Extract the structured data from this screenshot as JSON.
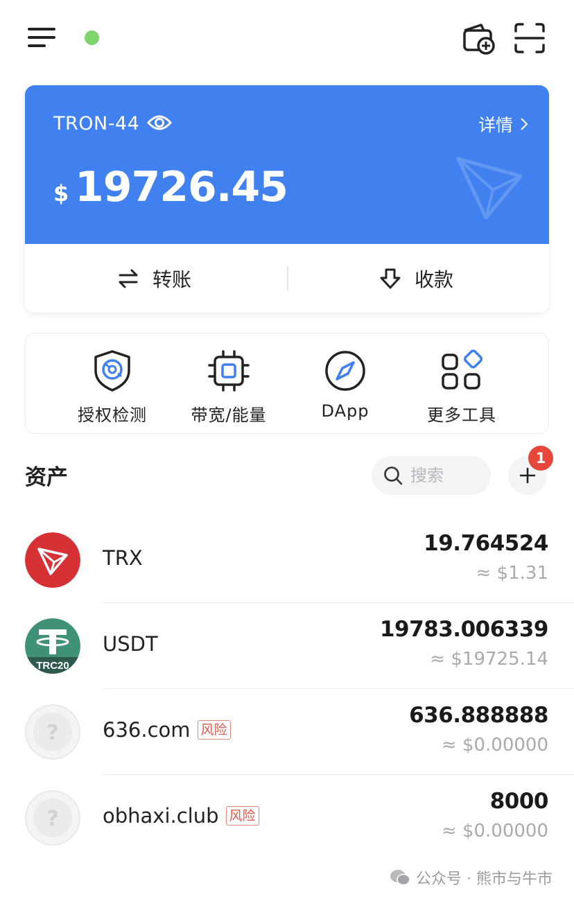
{
  "header": {
    "menu_icon": "hamburger-menu-icon",
    "status_color": "#7fd36a",
    "wallet_add_icon": "wallet-add-icon",
    "scan_icon": "scan-icon"
  },
  "card": {
    "wallet_name": "TRON-44",
    "details_label": "详情",
    "currency_sign": "$",
    "balance": "19726.45",
    "accent_color": "#4180ef",
    "transfer_label": "转账",
    "receive_label": "收款"
  },
  "tools": [
    {
      "label": "授权检测",
      "icon": "shield-check-icon"
    },
    {
      "label": "带宽/能量",
      "icon": "chip-icon"
    },
    {
      "label": "DApp",
      "icon": "compass-icon"
    },
    {
      "label": "更多工具",
      "icon": "grid-icon"
    }
  ],
  "assets": {
    "title": "资产",
    "search_placeholder": "搜索",
    "badge_count": "1",
    "items": [
      {
        "name": "TRX",
        "amount": "19.764524",
        "value": "≈ $1.31",
        "risk": ""
      },
      {
        "name": "USDT",
        "amount": "19783.006339",
        "value": "≈ $19725.14",
        "risk": "",
        "logo_text": "TRC20"
      },
      {
        "name": "636.com",
        "amount": "636.888888",
        "value": "≈ $0.00000",
        "risk": "风险"
      },
      {
        "name": "obhaxi.club",
        "amount": "8000",
        "value": "≈ $0.00000",
        "risk": "风险"
      }
    ]
  },
  "watermark": "公众号 · 熊市与牛市"
}
